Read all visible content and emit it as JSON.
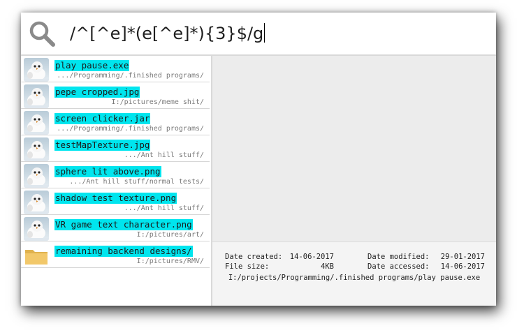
{
  "search": {
    "query": "/^[^e]*(e[^e]*){3}$/g"
  },
  "results": [
    {
      "name": "play pause.exe",
      "path": ".../Programming/.finished programs/",
      "icon": "snow-bird-thumbnail"
    },
    {
      "name": "pepe cropped.jpg",
      "path": "I:/pictures/meme shit/",
      "icon": "snow-bird-thumbnail"
    },
    {
      "name": "screen clicker.jar",
      "path": ".../Programming/.finished programs/",
      "icon": "snow-bird-thumbnail"
    },
    {
      "name": "testMapTexture.jpg",
      "path": ".../Ant hill stuff/",
      "icon": "snow-bird-thumbnail"
    },
    {
      "name": "sphere lit above.png",
      "path": ".../Ant hill stuff/normal tests/",
      "icon": "snow-bird-thumbnail"
    },
    {
      "name": "shadow test texture.png",
      "path": ".../Ant hill stuff/",
      "icon": "snow-bird-thumbnail"
    },
    {
      "name": "VR game text character.png",
      "path": "I:/pictures/art/",
      "icon": "snow-bird-thumbnail"
    },
    {
      "name": "remaining backend designs/",
      "path": "I:/pictures/RMV/",
      "icon": "folder-icon"
    }
  ],
  "details": {
    "created_label": "Date created:",
    "created_value": "14-06-2017",
    "modified_label": "Date modified:",
    "modified_value": "29-01-2017",
    "size_label": "File size:",
    "size_value": "4KB",
    "accessed_label": "Date accessed:",
    "accessed_value": "14-06-2017",
    "full_path": "I:/projects/Programming/.finished programs/play pause.exe"
  },
  "colors": {
    "highlight": "#00e5ee",
    "preview_bg": "#ececec",
    "folder": "#f2c86a"
  }
}
